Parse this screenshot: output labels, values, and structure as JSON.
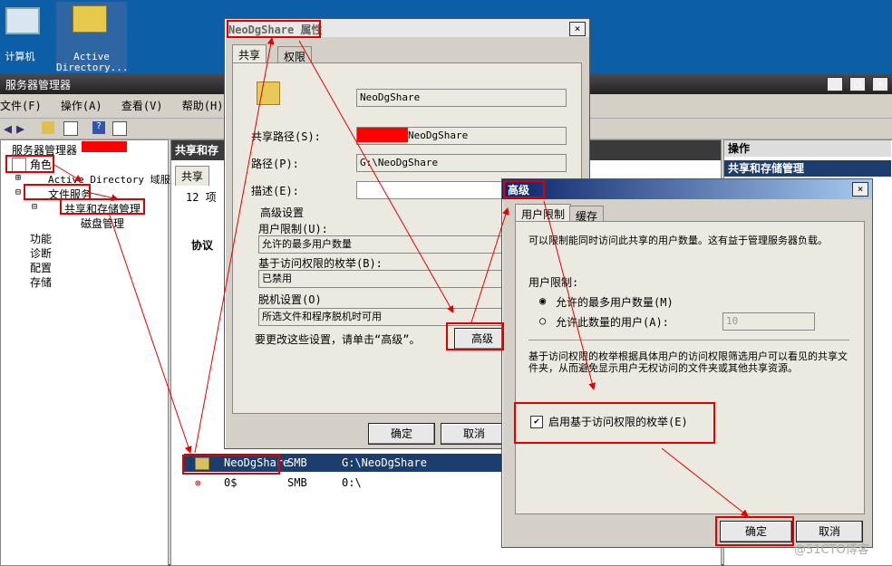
{
  "desktop": {
    "computer_label": "计算机",
    "ad_label_line1": "Active",
    "ad_label_line2": "Directory..."
  },
  "server_manager": {
    "title": "服务器管理器",
    "menu": [
      "文件(F)",
      "操作(A)",
      "查看(V)",
      "帮助(H)"
    ],
    "tree": {
      "root": "服务器管理器",
      "roles": "角色",
      "ad": "Active Directory 域服务",
      "file_services": "文件服务",
      "share_storage": "共享和存储管理",
      "disk_mgmt": "磁盘管理",
      "features": "功能",
      "diagnostics": "诊断",
      "config": "配置",
      "storage": "存储"
    },
    "middle_header": "共享和存",
    "middle_tab": "共享",
    "item_count": "12 项",
    "group_label": "协议",
    "rows": [
      {
        "name": "NeoDgShare",
        "protocol": "SMB",
        "path": "G:\\NeoDgShare"
      },
      {
        "name": "0$",
        "protocol": "SMB",
        "path": "0:\\"
      }
    ],
    "actions_header": "操作",
    "actions_sub": "共享和存储管理"
  },
  "props_dialog": {
    "title": "NeoDgShare 属性",
    "tabs": [
      "共享",
      "权限"
    ],
    "share_name": "NeoDgShare",
    "share_path_label": "共享路径(S):",
    "share_path_value": "NeoDgShare",
    "path_label": "路径(P):",
    "path_value": "G:\\NeoDgShare",
    "desc_label": "描述(E):",
    "adv_group": "高级设置",
    "user_limit_label": "用户限制(U):",
    "user_limit_value": "允许的最多用户数量",
    "abe_label": "基于访问权限的枚举(B):",
    "abe_value": "已禁用",
    "offline_label": "脱机设置(O)",
    "offline_value": "所选文件和程序脱机时可用",
    "change_hint": "要更改这些设置，请单击“高级”。",
    "advanced_btn": "高级",
    "ok_btn": "确定",
    "cancel_btn": "取消"
  },
  "adv_dialog": {
    "title": "高级",
    "tabs": [
      "用户限制",
      "缓存"
    ],
    "intro": "可以限制能同时访问此共享的用户数量。这有益于管理服务器负载。",
    "user_limit_group": "用户限制:",
    "radio_max": "允许的最多用户数量(M)",
    "radio_users": "允许此数量的用户(A):",
    "users_value": "10",
    "abe_desc": "基于访问权限的枚举根据具体用户的访问权限筛选用户可以看见的共享文件夹，从而避免显示用户无权访问的文件夹或其他共享资源。",
    "abe_checkbox": "启用基于访问权限的枚举(E)",
    "abe_checked": true,
    "ok_btn": "确定",
    "cancel_btn": "取消"
  },
  "watermark": "@51CTO博客",
  "colors": {
    "annotation_red": "#e00000",
    "selection_blue": "#1c3e6e"
  }
}
